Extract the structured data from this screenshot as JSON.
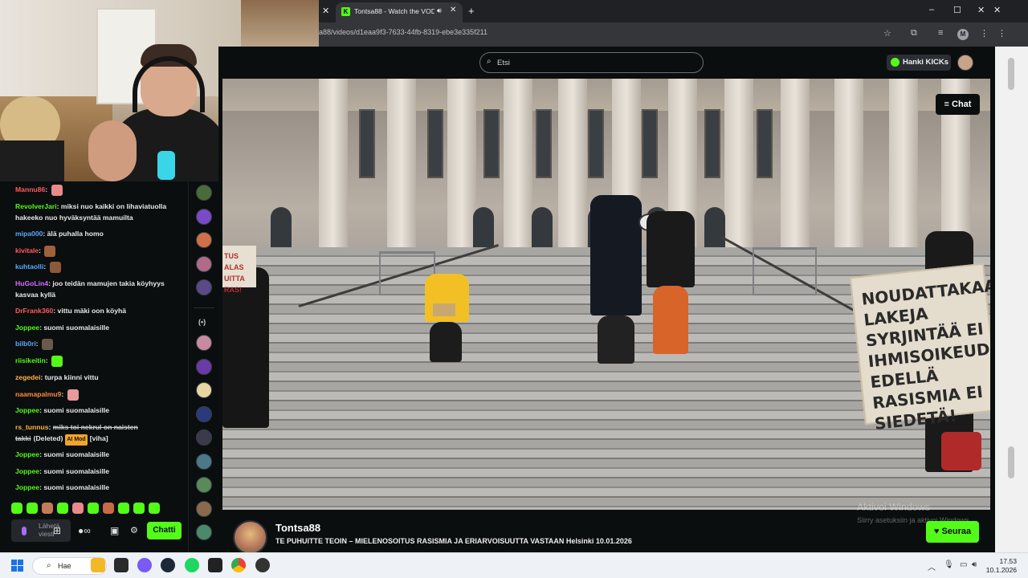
{
  "browser": {
    "tab_title": "Tontsa88 - Watch the VOD",
    "url": "a88/videos/d1eaa9f3-7633-44fb-8319-ebe3e335f211",
    "profile_initial": "M"
  },
  "topnav": {
    "search_placeholder": "Etsi",
    "hanki_label": "Hanki KICKs"
  },
  "video": {
    "chat_toggle_label": "Chat",
    "sign_right": "NOUDATTAKAA LAKEJA SYRJINTÄÄ EI IHMISOIKEUDET EDELLÄ RASISMIA EI SIEDETÄ!",
    "sign_left": "TUS ALAS UITTA RAS!"
  },
  "channel": {
    "name": "Tontsa88",
    "title": "TE PUHUITTE TEOIN – MIELENOSOITUS RASISMIA JA ERIARVOISUUTTA VASTAAN Helsinki 10.01.2026",
    "follow_label": "Seuraa"
  },
  "windows_watermark": {
    "line1": "Aktivoi Windows",
    "line2": "Siirry asetuksiin ja aktivoi Windows."
  },
  "chat": {
    "messages": [
      {
        "user": "Mannu86",
        "color": "#ff5b5b",
        "text": ""
      },
      {
        "user": "RevolverJari",
        "color": "#53fc18",
        "text": "miksi nuo kaikki on lihaviatuolla hakeeko nuo hyväksyntää mamuilta"
      },
      {
        "user": "mipa000",
        "color": "#5aa9ff",
        "text": "älä puhalla homo"
      },
      {
        "user": "kivitale",
        "color": "#ff5b5b",
        "text": ""
      },
      {
        "user": "kuhtaolli",
        "color": "#5aa9ff",
        "text": ""
      },
      {
        "user": "HuGoLin4",
        "color": "#d86bff",
        "text": "joo teidän mamujen takia köyhyys kasvaa kyllä"
      },
      {
        "user": "DrFrank360",
        "color": "#ff5b5b",
        "text": "vittu mäki oon köyhä"
      },
      {
        "user": "Joppee",
        "color": "#53fc18",
        "text": "suomi suomalaisille"
      },
      {
        "user": "bilb0ri",
        "color": "#5aa9ff",
        "text": ""
      },
      {
        "user": "riisikeitin",
        "color": "#53fc18",
        "text": ""
      },
      {
        "user": "zegedei",
        "color": "#ffb347",
        "text": "turpa kiinni vittu"
      },
      {
        "user": "naamapalmu9",
        "color": "#ff8a3d",
        "text": ""
      },
      {
        "user": "Joppee",
        "color": "#53fc18",
        "text": "suomi suomalaisille"
      },
      {
        "user": "rs_tunnus",
        "color": "#ffb347",
        "text": "miks toi nekrul on naisten takki",
        "deleted_label": "(Deleted)",
        "mod_label": "AI Mod",
        "tag": "[viha]"
      },
      {
        "user": "Joppee",
        "color": "#53fc18",
        "text": "suomi suomalaisille"
      },
      {
        "user": "Joppee",
        "color": "#53fc18",
        "text": "suomi suomalaisille"
      },
      {
        "user": "Joppee",
        "color": "#53fc18",
        "text": "suomi suomalaisille"
      }
    ],
    "input_placeholder": "Lähetä viesti",
    "send_label": "Chatti"
  },
  "rail": {
    "more_label": "(•)"
  },
  "taskbar": {
    "search_label": "Hae",
    "time": "17.53",
    "date": "10.1.2026"
  },
  "colors": {
    "kick_green": "#53fc18",
    "background": "#0b0e0f"
  }
}
